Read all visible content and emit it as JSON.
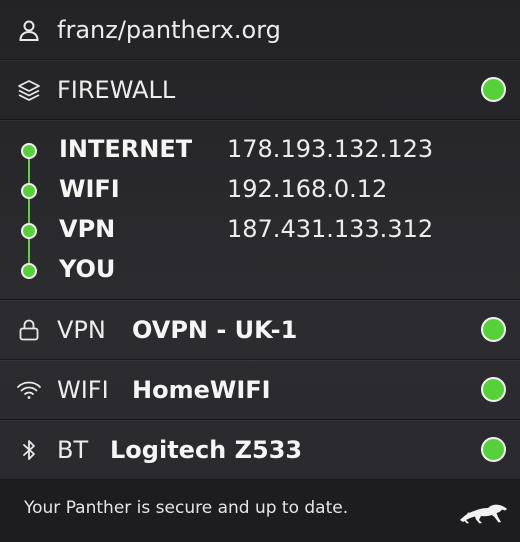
{
  "user": {
    "account": "franz/pantherx.org",
    "icon": "user-icon"
  },
  "firewall": {
    "label": "FIREWALL",
    "icon": "layers-icon",
    "status_color": "#57d13a"
  },
  "connection_chain": [
    {
      "name": "INTERNET",
      "ip": "178.193.132.123"
    },
    {
      "name": "WIFI",
      "ip": "192.168.0.12"
    },
    {
      "name": "VPN",
      "ip": "187.431.133.312"
    },
    {
      "name": "YOU",
      "ip": ""
    }
  ],
  "vpn": {
    "label": "VPN",
    "value": "OVPN - UK-1",
    "icon": "lock-icon",
    "status_color": "#57d13a"
  },
  "wifi": {
    "label": "WIFI",
    "value": "HomeWIFI",
    "icon": "wifi-icon",
    "status_color": "#57d13a"
  },
  "bt": {
    "label": "BT",
    "value": "Logitech Z533",
    "icon": "bluetooth-icon",
    "status_color": "#57d13a"
  },
  "footer": {
    "message": "Your Panther is secure and up to date.",
    "logo": "panther-logo-icon"
  },
  "colors": {
    "accent_green": "#57d13a",
    "background": "#26262b",
    "footer": "#1d1d20"
  }
}
